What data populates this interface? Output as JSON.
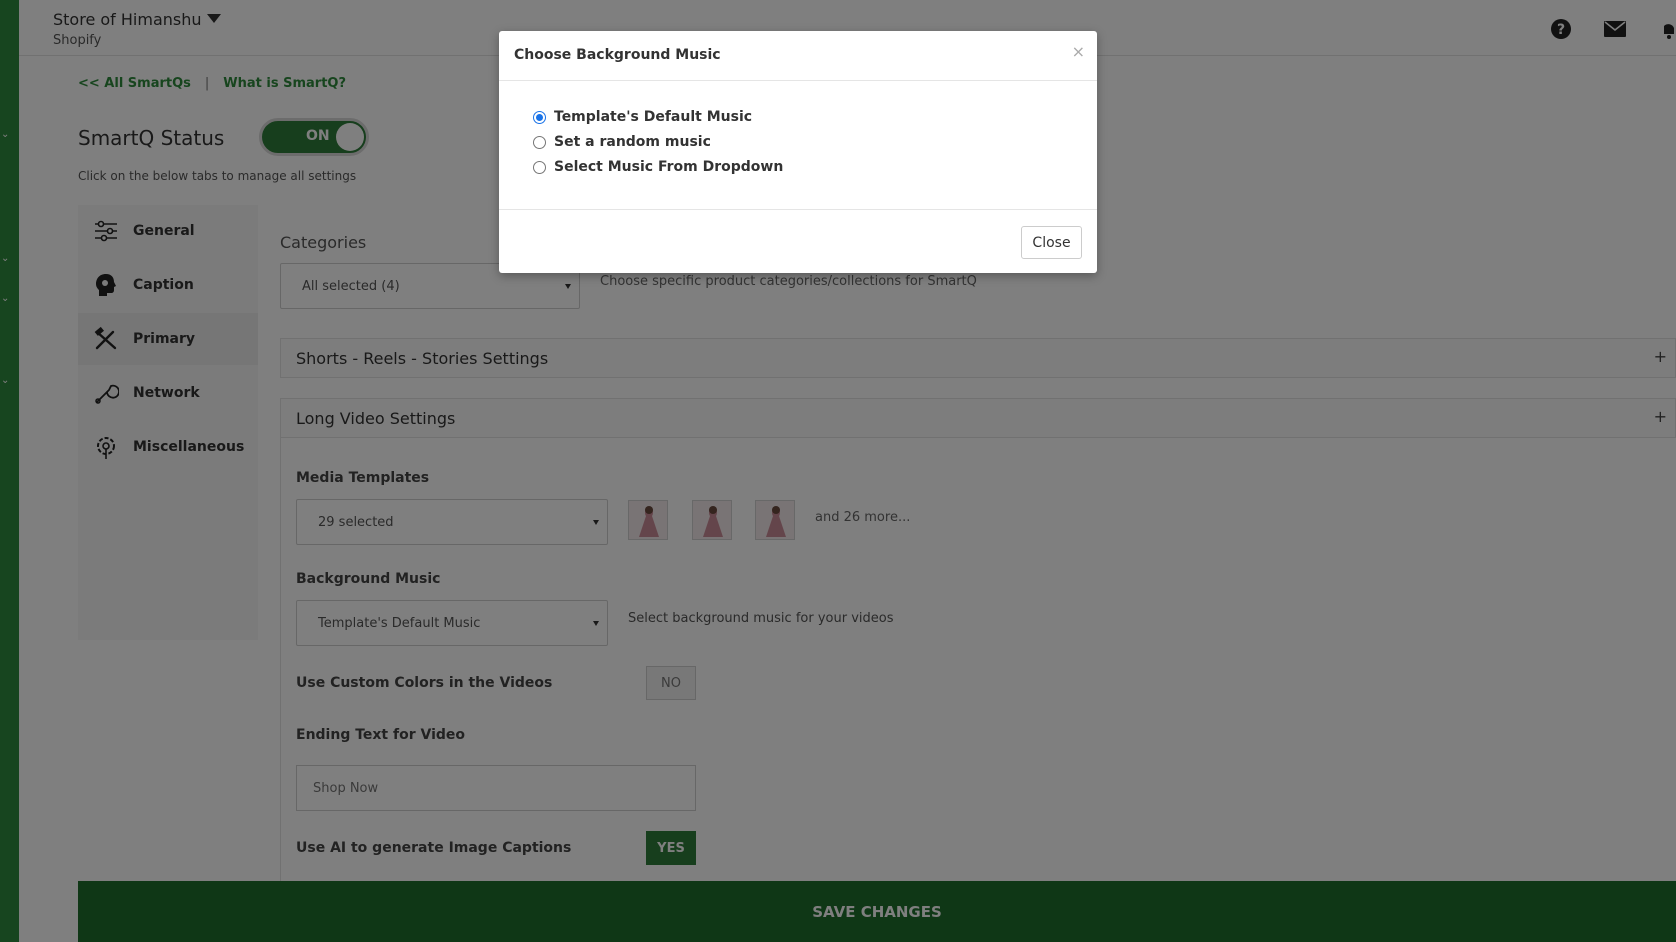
{
  "topbar": {
    "store_name": "Store of Himanshu",
    "store_platform": "Shopify"
  },
  "links": {
    "all_smartqs": "<< All SmartQs",
    "separator": "|",
    "what_is": "What is SmartQ?"
  },
  "status": {
    "title": "SmartQ Status",
    "toggle_label": "ON",
    "help_text": "Click on the below tabs to manage all settings"
  },
  "tabs": [
    {
      "label": "General",
      "icon": "sliders-icon"
    },
    {
      "label": "Caption",
      "icon": "head-icon"
    },
    {
      "label": "Primary",
      "icon": "tools-icon"
    },
    {
      "label": "Network",
      "icon": "wrench-icon"
    },
    {
      "label": "Miscellaneous",
      "icon": "gear-icon"
    }
  ],
  "categories": {
    "label": "Categories",
    "value": "All selected (4)",
    "hint": "Choose specific product categories/collections for SmartQ"
  },
  "accordions": {
    "shorts_title": "Shorts - Reels - Stories Settings",
    "long_title": "Long Video Settings",
    "plus": "+"
  },
  "long_video": {
    "media_templates_label": "Media Templates",
    "media_templates_value": "29 selected",
    "more_text": "and 26 more...",
    "background_music_label": "Background Music",
    "background_music_value": "Template's Default Music",
    "background_music_hint": "Select background music for your videos",
    "custom_colors_label": "Use Custom Colors in the Videos",
    "custom_colors_value": "NO",
    "ending_text_label": "Ending Text for Video",
    "ending_text_placeholder": "Shop Now",
    "ai_captions_label": "Use AI to generate Image Captions",
    "ai_captions_value": "YES"
  },
  "save_button": "SAVE CHANGES",
  "modal": {
    "title": "Choose Background Music",
    "close_x": "×",
    "options": [
      {
        "label": "Template's Default Music",
        "checked": true
      },
      {
        "label": "Set a random music",
        "checked": false
      },
      {
        "label": "Select Music From Dropdown",
        "checked": false
      }
    ],
    "close_button": "Close"
  },
  "colors": {
    "accent_green": "#2e7d3a",
    "link_green": "#2e8b3c",
    "save_bar": "#1e6e2c",
    "radio_blue": "#1a73e8"
  }
}
